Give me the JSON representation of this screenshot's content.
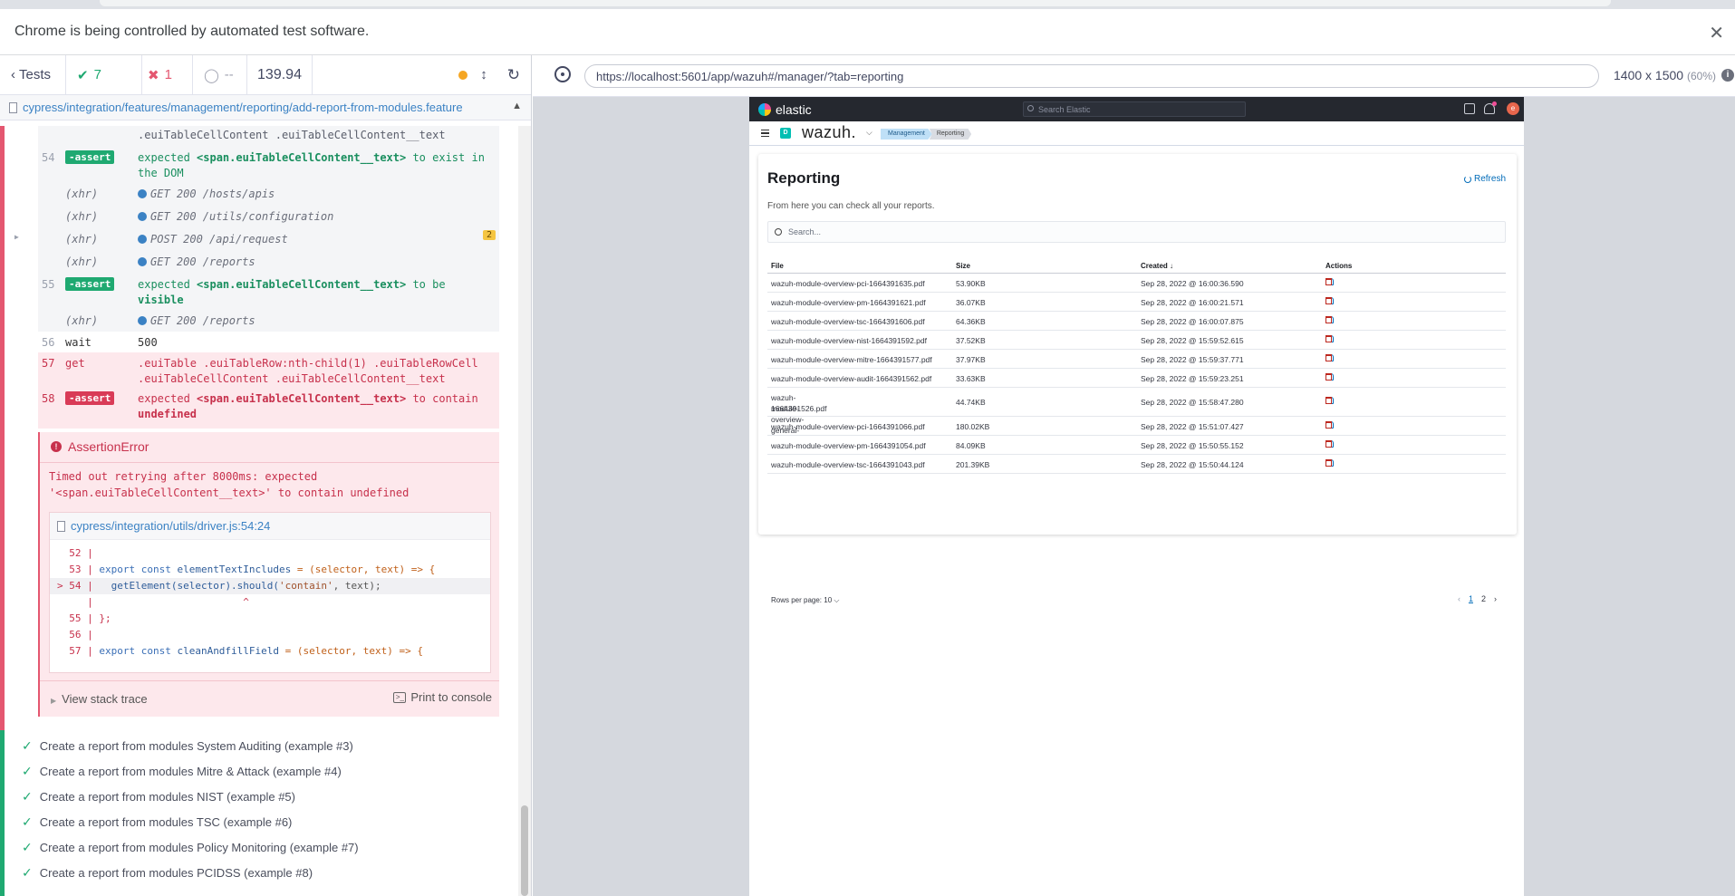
{
  "browser": {
    "automation_notice": "Chrome is being controlled by automated test software.",
    "close_glyph": "✕"
  },
  "reporter": {
    "tests_label": "Tests",
    "passed": "7",
    "failed": "1",
    "pending": "--",
    "duration": "139.94",
    "spec_path": "cypress/integration/features/management/reporting/add-report-from-modules.feature",
    "commands": [
      {
        "num": "",
        "name": "",
        "msg": ".euiTableCellContent .euiTableCellContent__text"
      },
      {
        "num": "54",
        "name": "-assert",
        "msg_pre": "expected",
        "selector": "<span.euiTableCellContent__text>",
        "msg_post": "to exist in the DOM"
      },
      {
        "kind": "xhr",
        "label": "(xhr)",
        "msg": "GET 200 /hosts/apis"
      },
      {
        "kind": "xhr",
        "label": "(xhr)",
        "msg": "GET 200 /utils/configuration"
      },
      {
        "kind": "xhr",
        "label": "(xhr)",
        "msg": "POST 200 /api/request",
        "count": "2"
      },
      {
        "kind": "xhr",
        "label": "(xhr)",
        "msg": "GET 200 /reports"
      },
      {
        "num": "55",
        "name": "-assert",
        "msg_pre": "expected",
        "selector": "<span.euiTableCellContent__text>",
        "msg_post": "to be",
        "msg_strong": "visible"
      },
      {
        "kind": "xhr",
        "label": "(xhr)",
        "msg": "GET 200 /reports"
      },
      {
        "num": "56",
        "name": "wait",
        "msg": "500"
      },
      {
        "num": "57",
        "name": "get",
        "msg": ".euiTable .euiTableRow:nth-child(1) .euiTableRowCell .euiTableCellContent .euiTableCellContent__text"
      },
      {
        "num": "58",
        "name": "-assert",
        "msg_pre": "expected",
        "selector": "<span.euiTableCellContent__text>",
        "msg_post": "to contain",
        "msg_strong": "undefined"
      }
    ],
    "error": {
      "title": "AssertionError",
      "message": "Timed out retrying after 8000ms: expected '<span.euiTableCellContent__text>' to contain undefined",
      "file": "cypress/integration/utils/driver.js:54:24",
      "code_lines": {
        "l52": "  52 |",
        "l53_num": "  53 | ",
        "l53_a": "export const ",
        "l53_b": "elementTextIncludes",
        "l53_c": " = (selector, text) => {",
        "l54_num": "> 54 |   ",
        "l54_a": "getElement(selector).should(",
        "l54_b": "'contain'",
        "l54_c": ", text);",
        "caret": "     |                         ^",
        "l55": "  55 | };",
        "l56": "  56 |",
        "l57_num": "  57 | ",
        "l57_a": "export const ",
        "l57_b": "cleanAndfillField",
        "l57_c": " = (selector, text) => {"
      },
      "stack_trace_label": "View stack trace",
      "print_label": "Print to console"
    },
    "tests": [
      "Create a report from modules System Auditing (example #3)",
      "Create a report from modules Mitre & Attack (example #4)",
      "Create a report from modules NIST (example #5)",
      "Create a report from modules TSC (example #6)",
      "Create a report from modules Policy Monitoring (example #7)",
      "Create a report from modules PCIDSS (example #8)"
    ]
  },
  "aut_header": {
    "url": "https://localhost:5601/app/wazuh#/manager/?tab=reporting",
    "viewport": "1400 x 1500",
    "viewport_pct": "(60%)"
  },
  "app": {
    "kibana_brand": "elastic",
    "search_placeholder": "Search Elastic",
    "avatar_letter": "e",
    "space_letter": "D",
    "wazuh_brand": "wazuh.",
    "breadcrumbs": [
      "Management",
      "Reporting"
    ],
    "page_title": "Reporting",
    "refresh_label": "Refresh",
    "description": "From here you can check all your reports.",
    "table_search_placeholder": "Search...",
    "columns": {
      "file": "File",
      "size": "Size",
      "created": "Created ↓",
      "actions": "Actions"
    },
    "rows": [
      {
        "file": "wazuh-module-overview-pci-1664391635.pdf",
        "size": "53.90KB",
        "created": "Sep 28, 2022 @ 16:00:36.590"
      },
      {
        "file": "wazuh-module-overview-pm-1664391621.pdf",
        "size": "36.07KB",
        "created": "Sep 28, 2022 @ 16:00:21.571"
      },
      {
        "file": "wazuh-module-overview-tsc-1664391606.pdf",
        "size": "64.36KB",
        "created": "Sep 28, 2022 @ 16:00:07.875"
      },
      {
        "file": "wazuh-module-overview-nist-1664391592.pdf",
        "size": "37.52KB",
        "created": "Sep 28, 2022 @ 15:59:52.615"
      },
      {
        "file": "wazuh-module-overview-mitre-1664391577.pdf",
        "size": "37.97KB",
        "created": "Sep 28, 2022 @ 15:59:37.771"
      },
      {
        "file": "wazuh-module-overview-audit-1664391562.pdf",
        "size": "33.63KB",
        "created": "Sep 28, 2022 @ 15:59:23.251"
      },
      {
        "file": "wazuh-module-overview-general-1664391526.pdf",
        "file_l1": "wazuh-module-overview-general-",
        "file_l2": "1664391526.pdf",
        "size": "44.74KB",
        "created": "Sep 28, 2022 @ 15:58:47.280"
      },
      {
        "file": "wazuh-module-overview-pci-1664391066.pdf",
        "size": "180.02KB",
        "created": "Sep 28, 2022 @ 15:51:07.427"
      },
      {
        "file": "wazuh-module-overview-pm-1664391054.pdf",
        "size": "84.09KB",
        "created": "Sep 28, 2022 @ 15:50:55.152"
      },
      {
        "file": "wazuh-module-overview-tsc-1664391043.pdf",
        "size": "201.39KB",
        "created": "Sep 28, 2022 @ 15:50:44.124"
      }
    ],
    "rows_per_page": "Rows per page: 10",
    "pages": [
      "1",
      "2"
    ]
  }
}
